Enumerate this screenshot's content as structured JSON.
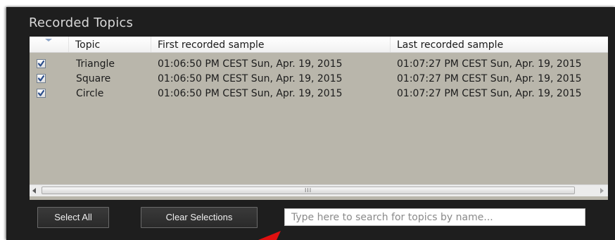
{
  "panel": {
    "title": "Recorded Topics"
  },
  "grid": {
    "columns": {
      "topic": "Topic",
      "first": "First recorded sample",
      "last": "Last recorded sample"
    },
    "rows": [
      {
        "checked": true,
        "topic": "Triangle",
        "first": "01:06:50 PM CEST  Sun, Apr. 19, 2015",
        "last": "01:07:27 PM CEST  Sun, Apr. 19, 2015"
      },
      {
        "checked": true,
        "topic": "Square",
        "first": "01:06:50 PM CEST  Sun, Apr. 19, 2015",
        "last": "01:07:27 PM CEST  Sun, Apr. 19, 2015"
      },
      {
        "checked": true,
        "topic": "Circle",
        "first": "01:06:50 PM CEST  Sun, Apr. 19, 2015",
        "last": "01:07:27 PM CEST  Sun, Apr. 19, 2015"
      }
    ],
    "scrollbar_grip": "III"
  },
  "buttons": {
    "select_all": "Select All",
    "clear_selections": "Clear Selections"
  },
  "search": {
    "placeholder": "Type here to search for topics by name...",
    "value": ""
  },
  "icons": {
    "sort": "sort-indicator-icon",
    "check": "checkmark-icon",
    "scroll_left": "scroll-left-arrow-icon",
    "scroll_right": "scroll-right-arrow-icon",
    "pointer": "red-arrow-pointer-icon"
  },
  "colors": {
    "panel_bg": "#1e1e1e",
    "grid_bg": "#b9b6ab",
    "check_color": "#2b4e8c",
    "pointer_color": "#e01010"
  }
}
